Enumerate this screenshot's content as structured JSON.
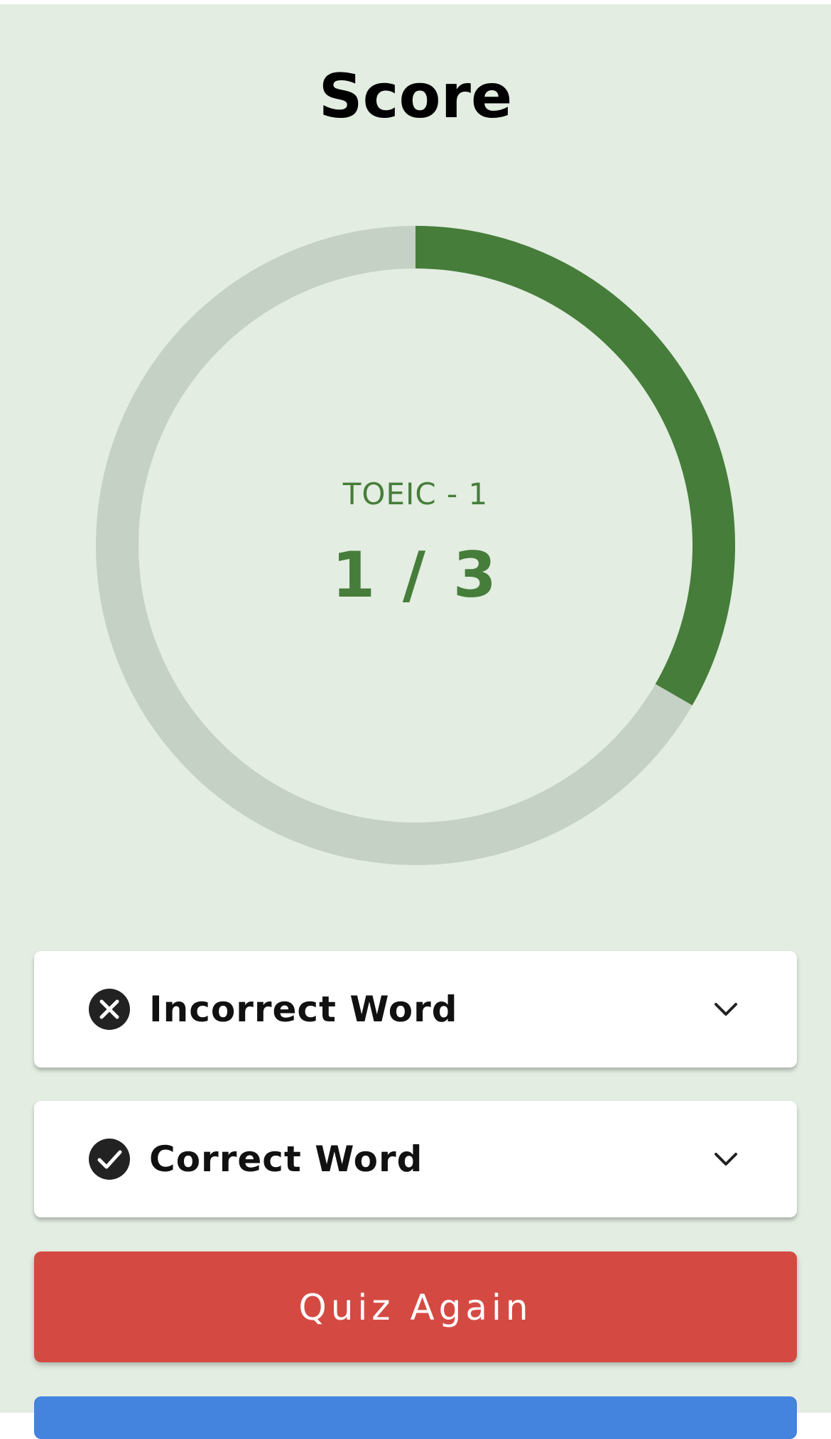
{
  "page": {
    "title": "Score"
  },
  "score": {
    "quiz_name": "TOEIC - 1",
    "display": "1 / 3",
    "correct": 1,
    "total": 3,
    "progress_color": "#467d3a",
    "track_color": "#c5d1c5"
  },
  "sections": [
    {
      "label": "Incorrect Word",
      "icon": "close-circle-icon"
    },
    {
      "label": "Correct Word",
      "icon": "check-circle-icon"
    }
  ],
  "buttons": {
    "quiz_again": "Quiz Again",
    "quiz_again_color": "#d44a42",
    "second_color": "#4483de"
  }
}
